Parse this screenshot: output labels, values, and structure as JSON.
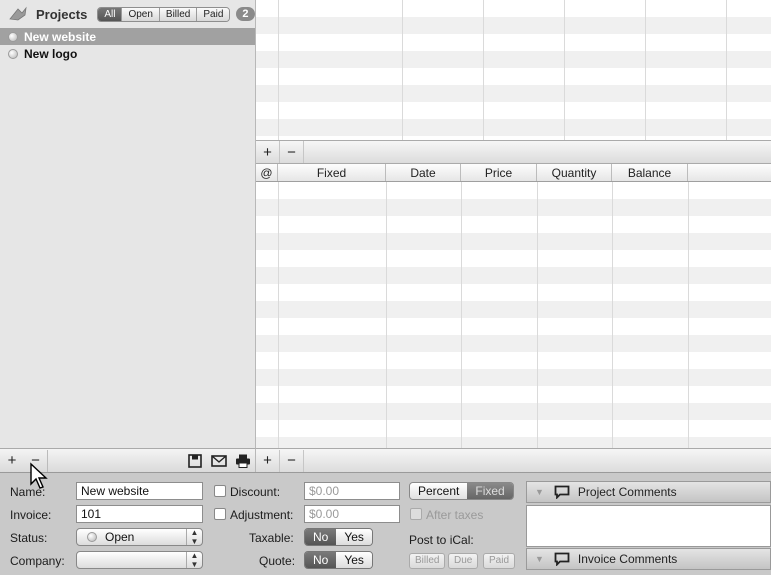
{
  "sidebar": {
    "title": "Projects",
    "filters": [
      {
        "label": "All",
        "active": true
      },
      {
        "label": "Open",
        "active": false
      },
      {
        "label": "Billed",
        "active": false
      },
      {
        "label": "Paid",
        "active": false
      }
    ],
    "count": "2",
    "projects": [
      {
        "name": "New website",
        "selected": true
      },
      {
        "name": "New logo",
        "selected": false
      }
    ]
  },
  "toolbar": {
    "add": "+",
    "remove": "−",
    "save_icon": "save-icon",
    "mail_icon": "mail-icon",
    "print_icon": "print-icon"
  },
  "top_table": {
    "add": "+",
    "remove": "−"
  },
  "line_items": {
    "columns": [
      "@",
      "Fixed",
      "Date",
      "Price",
      "Quantity",
      "Balance"
    ],
    "add": "+",
    "remove": "−"
  },
  "form": {
    "name_label": "Name:",
    "name_value": "New website",
    "invoice_label": "Invoice:",
    "invoice_value": "101",
    "status_label": "Status:",
    "status_value": "Open",
    "company_label": "Company:",
    "company_value": "",
    "discount_label": "Discount:",
    "discount_value": "$0.00",
    "adjustment_label": "Adjustment:",
    "adjustment_value": "$0.00",
    "taxable_label": "Taxable:",
    "quote_label": "Quote:",
    "no": "No",
    "yes": "Yes",
    "percent": "Percent",
    "fixed": "Fixed",
    "after_taxes": "After taxes",
    "post_ical": "Post to iCal:",
    "ical_billed": "Billed",
    "ical_due": "Due",
    "ical_paid": "Paid"
  },
  "comments": {
    "project": "Project Comments",
    "invoice": "Invoice Comments"
  }
}
